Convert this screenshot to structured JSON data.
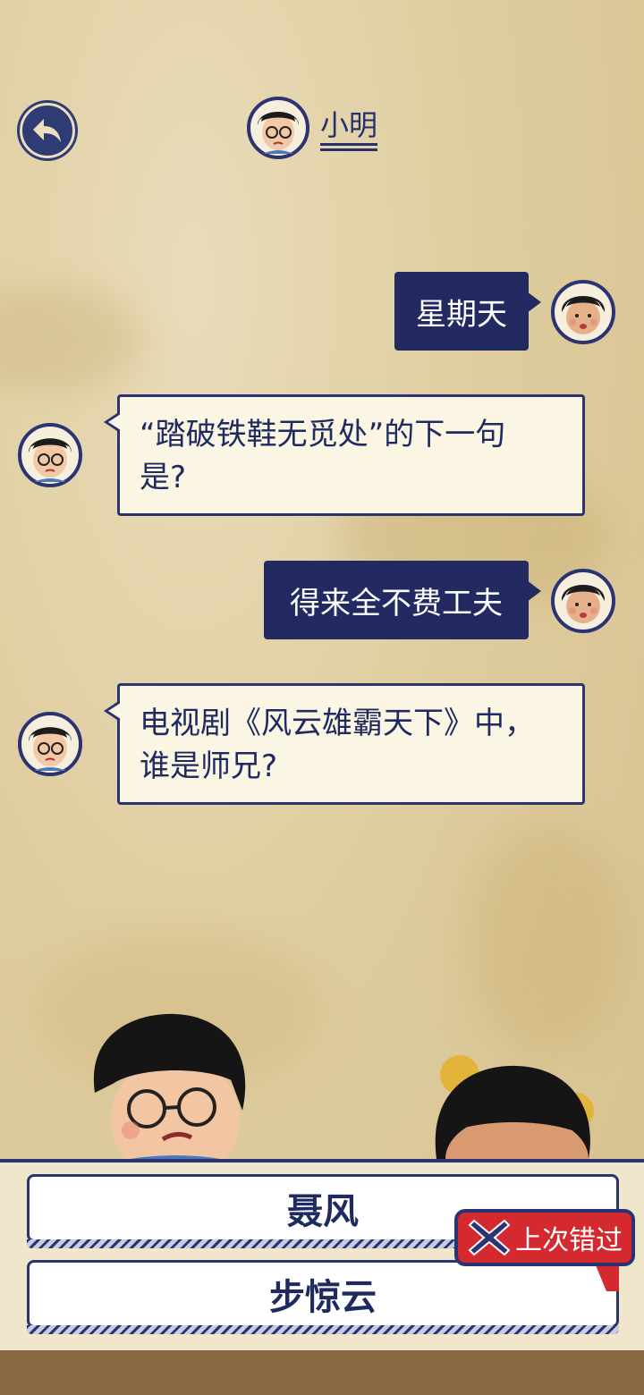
{
  "header": {
    "name": "小明",
    "back_icon": "back-arrow-icon"
  },
  "messages": [
    {
      "side": "right",
      "text": "星期天"
    },
    {
      "side": "left",
      "lines": [
        "“踏破铁鞋无觅处”的下一句",
        "是?"
      ]
    },
    {
      "side": "right",
      "text": "得来全不费工夫"
    },
    {
      "side": "left",
      "lines": [
        "电视剧《风云雄霸天下》中，",
        "谁是师兄?"
      ]
    }
  ],
  "options": [
    {
      "label": "聂风"
    },
    {
      "label": "步惊云"
    }
  ],
  "wrong_tag": {
    "label": "上次错过",
    "icon": "cross-icon"
  },
  "colors": {
    "navy": "#232a61",
    "accent_red": "#d42a2f",
    "paper": "#dfcd9f"
  }
}
